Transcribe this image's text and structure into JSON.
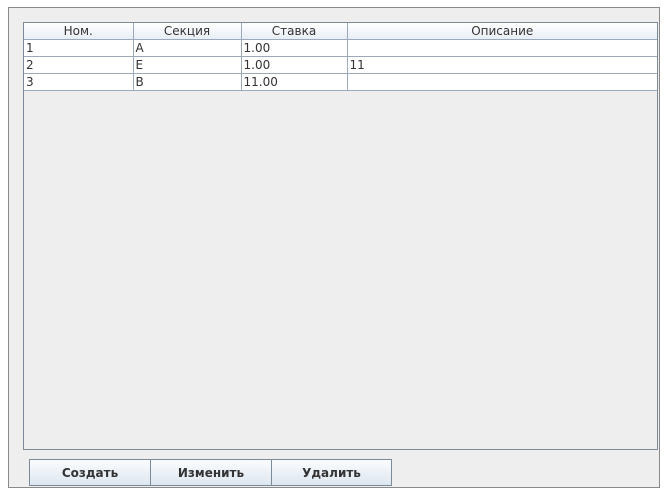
{
  "table": {
    "columns": [
      "Ном.",
      "Секция",
      "Ставка",
      "Описание"
    ],
    "rows": [
      [
        "1",
        "А",
        "1.00",
        ""
      ],
      [
        "2",
        "Е",
        "1.00",
        "11"
      ],
      [
        "3",
        "В",
        "11.00",
        ""
      ]
    ]
  },
  "buttons": {
    "create": "Создать",
    "edit": "Изменить",
    "delete": "Удалить"
  }
}
